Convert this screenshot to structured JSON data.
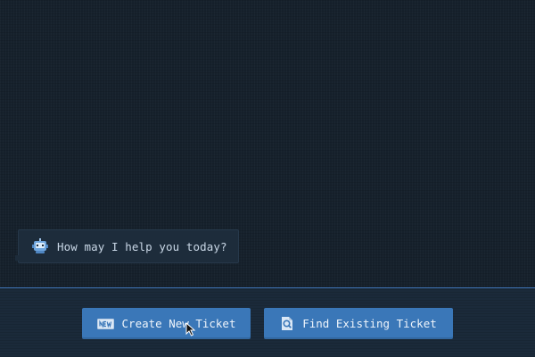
{
  "chat": {
    "bot_message": "How may I help you today?",
    "bot_avatar_icon": "robot-icon"
  },
  "actions": {
    "create_label": "Create New Ticket",
    "create_icon": "new-badge-icon",
    "find_label": "Find Existing Ticket",
    "find_icon": "search-document-icon"
  },
  "colors": {
    "background": "#16212c",
    "bubble": "#1d2c3b",
    "footer": "#1b2a3a",
    "accent": "#3a77b8",
    "footer_border": "#3f74b6"
  }
}
